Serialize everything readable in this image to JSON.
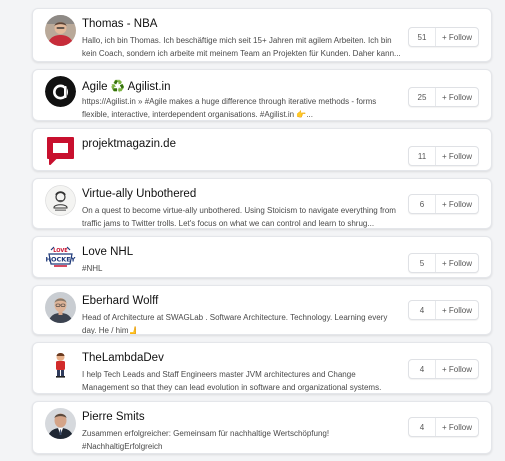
{
  "follow_label": "+ Follow",
  "accounts": [
    {
      "name": "Thomas - NBA",
      "description": "Hallo, ich bin Thomas. Ich beschäftige mich seit 15+ Jahren mit agilem Arbeiten. Ich bin kein Coach, sondern ich arbeite mit meinem Team an Projekten für Kunden. Daher kann...",
      "followers": "51",
      "avatar": "man-red-shirt-photo"
    },
    {
      "name": "Agile ♻️ Agilist.in",
      "description": "https://Agilist.in » #Agile makes a huge difference through iterative methods - forms flexible, interactive, interdependent organisations. #Agilist.in 👉...",
      "followers": "25",
      "avatar": "black-circle-a-logo"
    },
    {
      "name": "projektmagazin.de",
      "description": "",
      "followers": "11",
      "avatar": "red-speech-bubble-logo"
    },
    {
      "name": "Virtue-ally Unbothered",
      "description": "On a quest to become virtue-ally unbothered. Using Stoicism to navigate everything from traffic jams to Twitter trolls. Let's focus on what we can control and learn to shrug...",
      "followers": "6",
      "avatar": "bust-sketch-logo"
    },
    {
      "name": "Love NHL",
      "description": "#NHL",
      "followers": "5",
      "avatar": "love-hockey-logo"
    },
    {
      "name": "Eberhard Wolff",
      "description": "Head of Architecture at SWAGLab . Software Architecture. Technology. Learning every day. He / him🫸",
      "followers": "4",
      "avatar": "man-portrait-photo"
    },
    {
      "name": "TheLambdaDev",
      "description": "I help Tech Leads and Staff Engineers master JVM architectures and Change Management so that they can lead evolution in software and organizational systems.",
      "followers": "4",
      "avatar": "cartoon-figure"
    },
    {
      "name": "Pierre Smits",
      "description": "Zusammen erfolgreicher: Gemeinsam für nachhaltige Wertschöpfung! #NachhaltigErfolgreich",
      "followers": "4",
      "avatar": "man-suit-photo"
    }
  ],
  "colors": {
    "background": "#f3f4f6",
    "card": "#ffffff",
    "brand_red": "#c8102e"
  }
}
